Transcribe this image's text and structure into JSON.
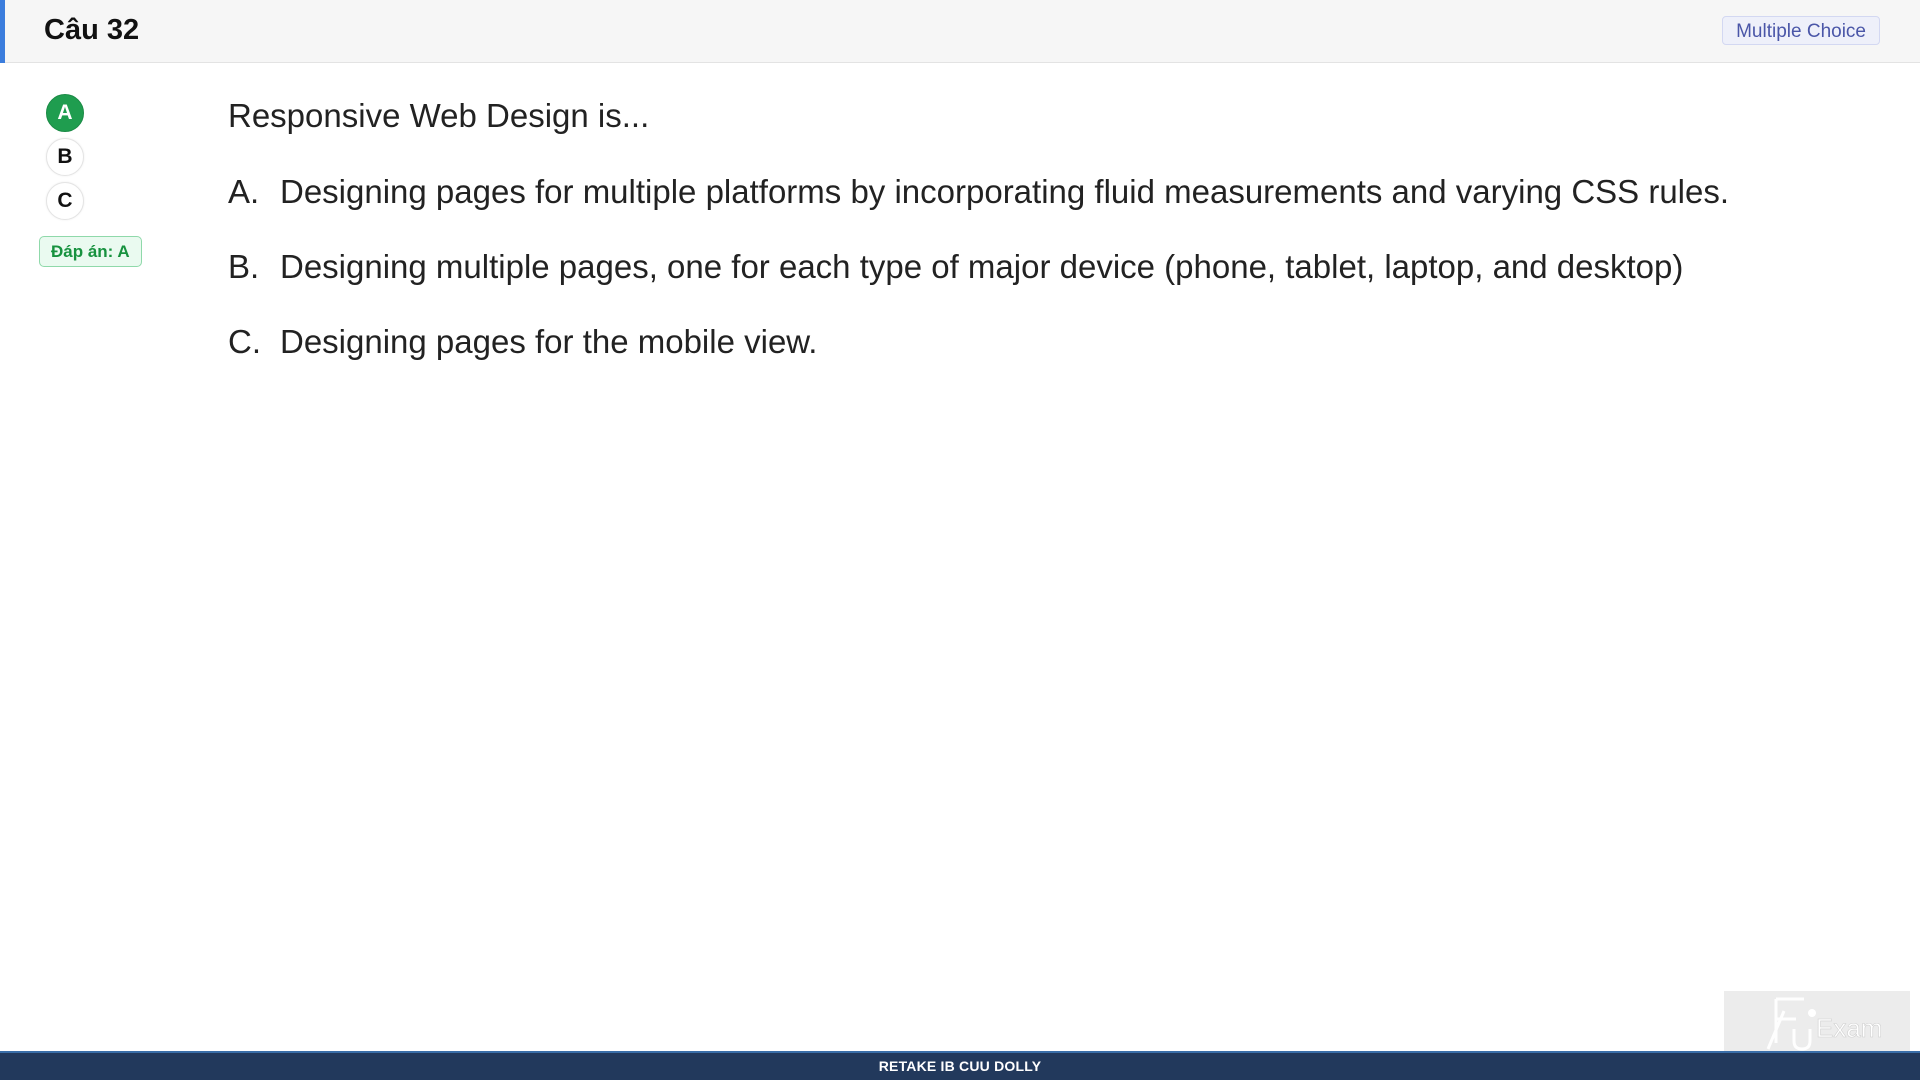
{
  "header": {
    "title": "Câu 32",
    "type_badge": "Multiple Choice",
    "accent_color": "#3b7ddd"
  },
  "choices": [
    {
      "letter": "A",
      "state": "correct"
    },
    {
      "letter": "B",
      "state": "normal"
    },
    {
      "letter": "C",
      "state": "normal"
    }
  ],
  "answer_badge": "Đáp án: A",
  "question": {
    "stem": "Responsive Web Design is...",
    "options": [
      {
        "letter": "A.",
        "text": "Designing pages for multiple platforms by incorporating fluid measurements and varying CSS rules."
      },
      {
        "letter": "B.",
        "text": "Designing multiple pages, one for each type of major device (phone, tablet, laptop, and desktop)"
      },
      {
        "letter": "C.",
        "text": "Designing pages for the mobile view."
      }
    ]
  },
  "footer": {
    "text": "RETAKE IB CUU DOLLY",
    "color": "#22395c"
  },
  "watermark": {
    "logo_text": "FUExam",
    "icon": "fu-exam-logo-icon"
  },
  "colors": {
    "correct": "#1f9d4f",
    "answer_badge_bg": "#eafaf0",
    "type_badge_text": "#4a56a8"
  }
}
